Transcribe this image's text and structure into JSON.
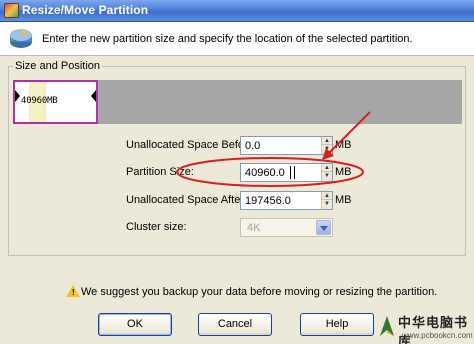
{
  "window": {
    "title": "Resize/Move Partition"
  },
  "header": {
    "instruction": "Enter the new partition size and specify the location of the selected partition."
  },
  "group": {
    "label": "Size and Position",
    "partition_label": "40960MB",
    "partition_fraction": 0.19
  },
  "fields": {
    "before_label": "Unallocated Space Before:",
    "before_value": "0.0",
    "size_label": "Partition Size:",
    "size_value": "40960.0",
    "after_label": "Unallocated Space After:",
    "after_value": "197456.0",
    "cluster_label": "Cluster size:",
    "cluster_value": "4K",
    "unit": "MB",
    "spin_up": "▲",
    "spin_down": "▼"
  },
  "warning": {
    "icon": "warning-icon",
    "mark": "!",
    "text": "We suggest you backup your data before moving or resizing the partition."
  },
  "buttons": {
    "ok": "OK",
    "cancel": "Cancel",
    "help": "Help"
  },
  "watermark": {
    "title": "中华电脑书库",
    "url": "www.pcbookcn.com"
  },
  "colors": {
    "annotation": "#d81e1e",
    "partition_border": "#b02fb0",
    "title_bar": "#4f7fd8"
  }
}
